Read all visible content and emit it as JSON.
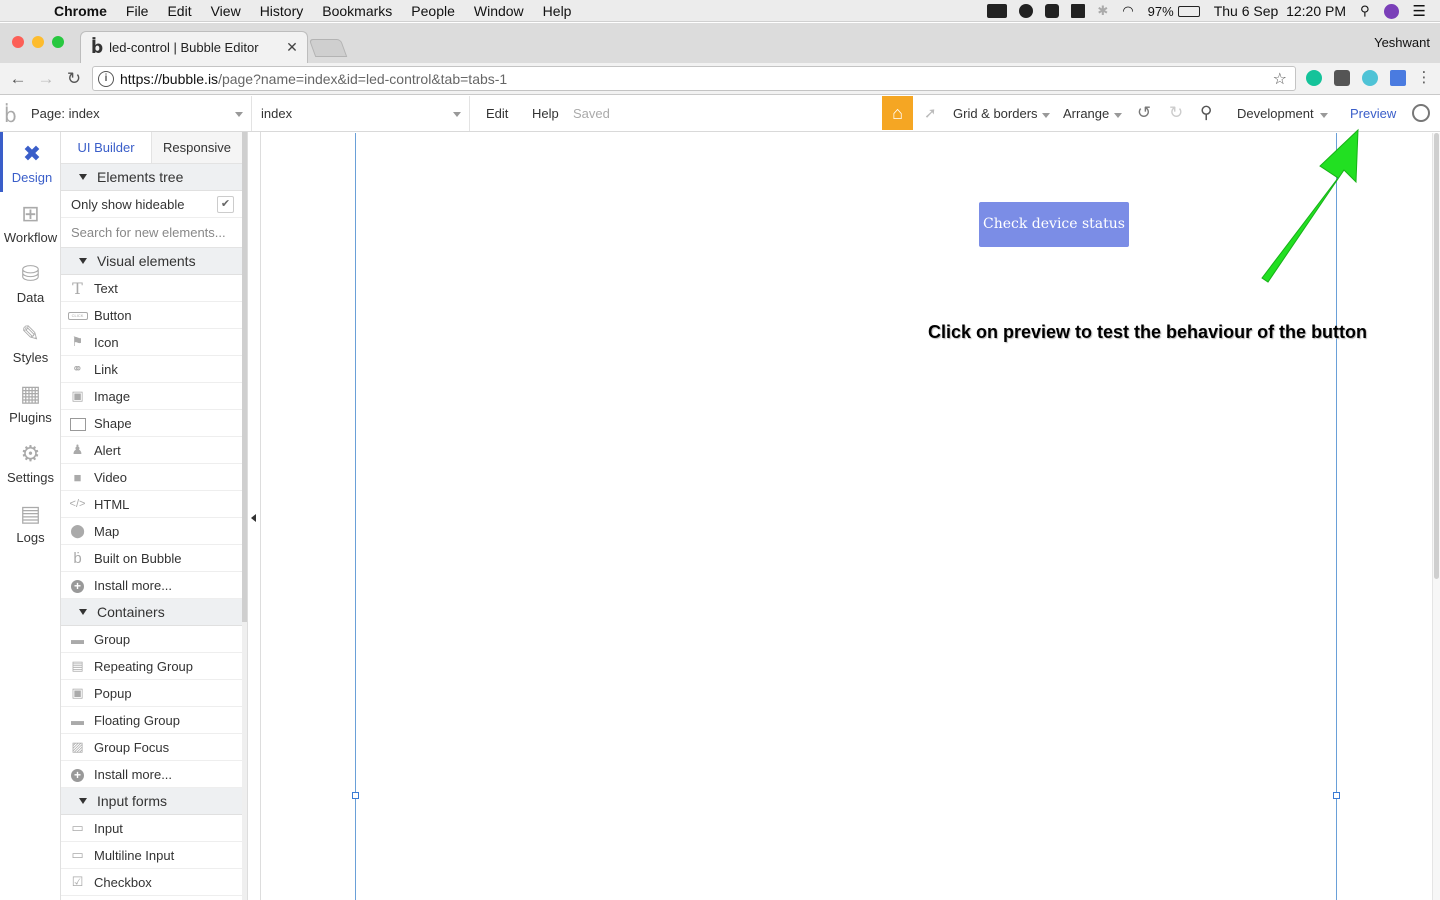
{
  "menubar": {
    "app": "Chrome",
    "items": [
      "File",
      "Edit",
      "View",
      "History",
      "Bookmarks",
      "People",
      "Window",
      "Help"
    ],
    "battery": "97%",
    "datetime": "Thu 6 Sep  12:20 PM"
  },
  "browser": {
    "tab_title": "led-control | Bubble Editor",
    "profile_name": "Yeshwant",
    "url_host": "https://bubble.is",
    "url_path": "/page?name=index&id=led-control&tab=tabs-1"
  },
  "editor_bar": {
    "page_label": "Page: index",
    "element_select": "index",
    "edit": "Edit",
    "help": "Help",
    "saved": "Saved",
    "grid": "Grid & borders",
    "arrange": "Arrange",
    "environment": "Development",
    "preview": "Preview"
  },
  "rail": [
    {
      "label": "Design",
      "icon": "design-icon"
    },
    {
      "label": "Workflow",
      "icon": "workflow-icon"
    },
    {
      "label": "Data",
      "icon": "database-icon"
    },
    {
      "label": "Styles",
      "icon": "brush-icon"
    },
    {
      "label": "Plugins",
      "icon": "plugin-icon"
    },
    {
      "label": "Settings",
      "icon": "gear-icon"
    },
    {
      "label": "Logs",
      "icon": "document-icon"
    }
  ],
  "palette": {
    "tabs": [
      "UI Builder",
      "Responsive"
    ],
    "elements_tree": "Elements tree",
    "only_hideable": "Only show hideable",
    "search_placeholder": "Search for new elements...",
    "visual_header": "Visual elements",
    "visual": [
      "Text",
      "Button",
      "Icon",
      "Link",
      "Image",
      "Shape",
      "Alert",
      "Video",
      "HTML",
      "Map",
      "Built on Bubble",
      "Install more..."
    ],
    "containers_header": "Containers",
    "containers": [
      "Group",
      "Repeating Group",
      "Popup",
      "Floating Group",
      "Group Focus",
      "Install more..."
    ],
    "inputs_header": "Input forms",
    "inputs": [
      "Input",
      "Multiline Input",
      "Checkbox"
    ]
  },
  "canvas": {
    "button_label": "Check device status",
    "annotation": "Click on preview to test the behaviour of the button",
    "arrow_color": "#22e022",
    "button_color": "#7b8de6"
  }
}
